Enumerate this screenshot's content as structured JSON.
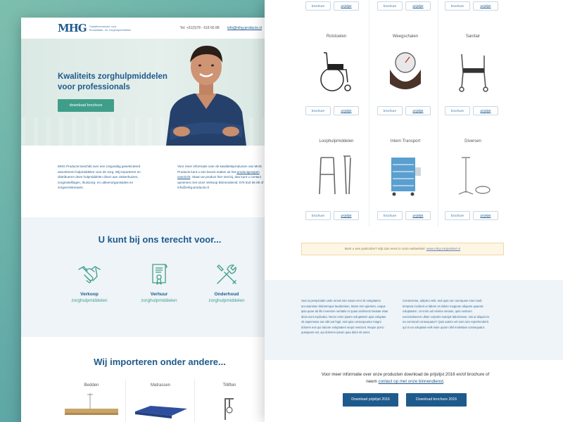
{
  "header": {
    "logo": "MHG",
    "tagline_1": "Totaalleverancier voor",
    "tagline_2": "Revalidatie- en Zorghulpmiddelen",
    "phone": "Tel: +31(0)78 - 618 66 88",
    "email": "info@mhg-products.nl"
  },
  "hero": {
    "title": "Kwaliteits zorghulpmiddelen voor professionals",
    "button": "download brochure"
  },
  "intro": {
    "left": "MHG Products beschikt over een zorgvuldig geselecteerd assortiment hulpmiddelen voor de zorg. Wij importeren en distribueren deze hulpmiddelen direct aan ziekenhuizen, zorginstellingen, thuiszorg- en uitleenorganisaties en zorgverzekeraars.",
    "right_before": "Voor meer informatie over de kwaliteitsproducten van MHG Products kunt u een keuze maken uit het",
    "right_link": "productgroepen overzicht",
    "right_after": ". Staat uw product hier niet bij, dan kunt u contact opnemen met onze Verkoop Binnendienst: 078 618 66 88 of via info@mhg-products.nl"
  },
  "services": {
    "title": "U kunt bij ons terecht voor...",
    "items": [
      {
        "title": "Verkoop",
        "subtitle": "zorghulpmiddelen",
        "icon": "handshake-icon"
      },
      {
        "title": "Verhuur",
        "subtitle": "zorghulpmiddelen",
        "icon": "contract-icon"
      },
      {
        "title": "Onderhoud",
        "subtitle": "zorghulpmiddelen",
        "icon": "tools-icon"
      }
    ]
  },
  "imports": {
    "title": "Wij importeren onder andere...",
    "categories": [
      "Bedden",
      "Matrassen",
      "Tilliften"
    ]
  },
  "products": {
    "brochure_label": "brochure",
    "pricelist_label": "prijslijst",
    "items": [
      "Rolstoelen",
      "Weegschalen",
      "Sanitair",
      "Loophulpmiddelen",
      "Intern Transport",
      "Diversen"
    ]
  },
  "particulier": {
    "text": "Bent u een particulier? Kijk dan eens in onze webwinkel:",
    "link": "www.mhg-zorgwinkel.nl"
  },
  "lorem": {
    "left": "Sed ut perspiciatis unde omnis iste natus error sit voluptatem accusantium doloremque laudantium, totam rem aperiam, eaque ipsa quae ab illo inventore veritatis et quasi architecto beatae vitae dicta sunt explicabo. Nemo enim ipsam voluptatem quia voluptas sit aspernatur aut odit aut fugit, sed quia consequuntur magni dolores eos qui ratione voluptatem sequi nesciunt. Neque porro quisquam est, qui dolorem ipsum quia dolor sit amet.",
    "right": "Consectetur, adipisci velit, sed quia non numquam eius modi tempora incidunt ut labore et dolore magnam aliquam quaerat voluptatem. Ut enim ad minima veniam, quis nostrum exercitationem ullam corporis suscipit laboriosam, nisi ut aliquid ex ea commodi consequatur? Quis autem vel eum iure reprehenderit qui in ea voluptate velit esse quam nihil molestiae consequatur."
  },
  "cta": {
    "text_before": "Voor meer informatie over onze producten download de prijslijst 2016 en/of brochure of neem",
    "link": "contact op met onze binnendienst",
    "text_after": ".",
    "button_pricelist": "Download prijslijst 2016",
    "button_brochure": "Download brochure 2016"
  },
  "colors": {
    "brand_blue": "#1e5a8c",
    "teal": "#3f9e8a"
  }
}
